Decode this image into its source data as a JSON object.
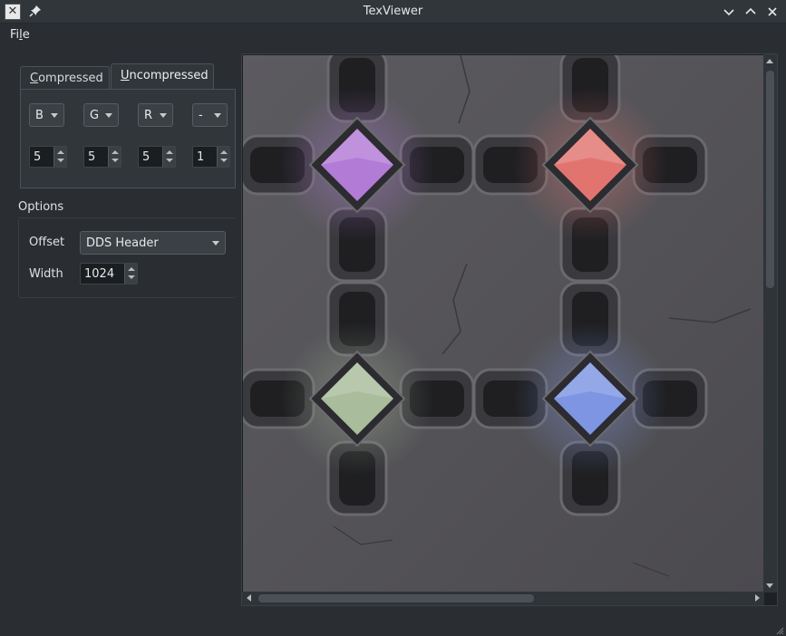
{
  "window": {
    "title": "TexViewer"
  },
  "menu": {
    "file_prefix": "Fi",
    "file_accel": "l",
    "file_suffix": "e"
  },
  "tabs": [
    {
      "accel": "C",
      "rest": "ompressed"
    },
    {
      "accel": "U",
      "rest": "ncompressed"
    }
  ],
  "channels": {
    "selects": [
      "B",
      "G",
      "R",
      "-"
    ],
    "bits": [
      "5",
      "5",
      "5",
      "1"
    ]
  },
  "options": {
    "title": "Options",
    "offset_label": "Offset",
    "offset_value": "DDS Header",
    "width_label": "Width",
    "width_value": "1024"
  },
  "texture": {
    "gem_colors": [
      "#b27bd6",
      "#e27470",
      "#a9bc9c",
      "#7d95e2"
    ]
  }
}
